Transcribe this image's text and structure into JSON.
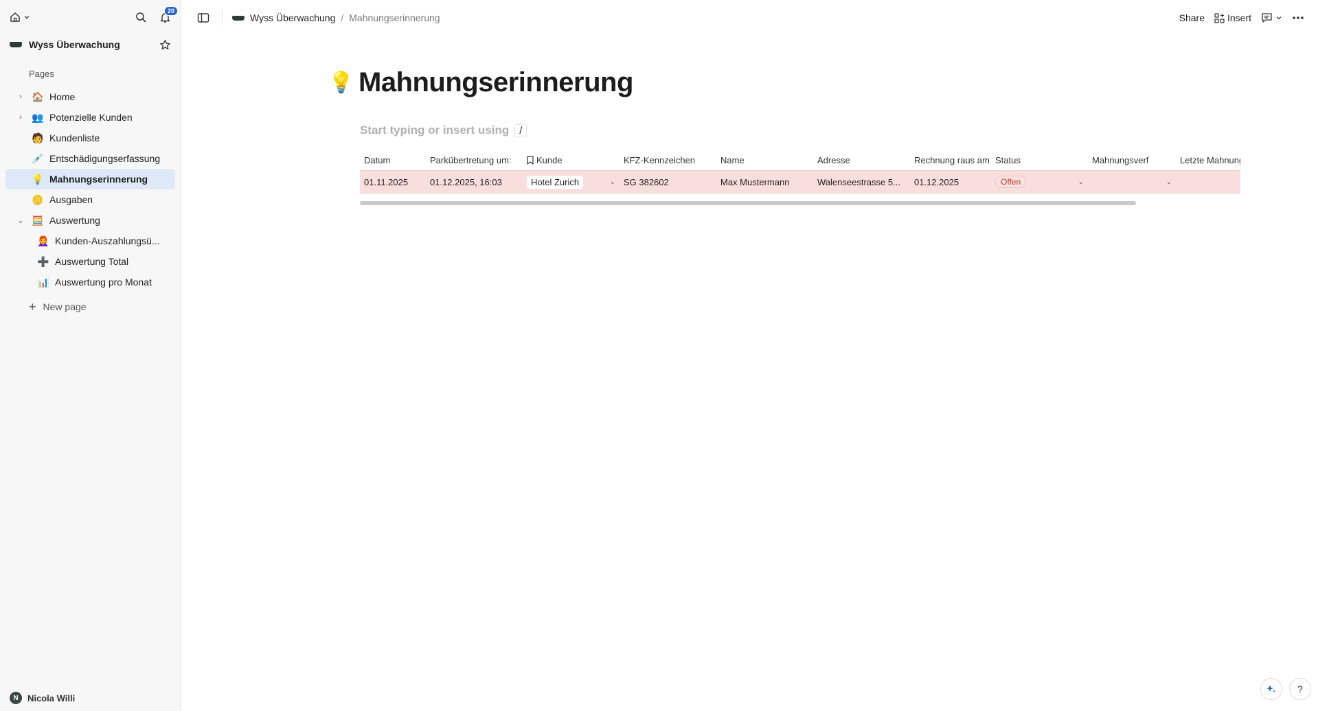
{
  "sidebar": {
    "workspace_name": "Wyss Überwachung",
    "notification_count": "20",
    "pages_label": "Pages",
    "items": [
      {
        "label": "Home"
      },
      {
        "label": "Potenzielle Kunden"
      },
      {
        "label": "Kundenliste"
      },
      {
        "label": "Entschädigungserfassung"
      },
      {
        "label": "Mahnungserinnerung"
      },
      {
        "label": "Ausgaben"
      },
      {
        "label": "Auswertung"
      },
      {
        "label": "Kunden-Auszahlungsü..."
      },
      {
        "label": "Auswertung Total"
      },
      {
        "label": "Auswertung pro Monat"
      }
    ],
    "new_page_label": "New page",
    "user_initial": "N",
    "user_name": "Nicola Willi"
  },
  "topbar": {
    "breadcrumb_workspace": "Wyss Überwachung",
    "breadcrumb_separator": "/",
    "breadcrumb_page": "Mahnungserinnerung",
    "share_label": "Share",
    "insert_label": "Insert"
  },
  "page": {
    "title": "Mahnungserinnerung",
    "hint_text": "Start typing or insert using",
    "hint_key": "/"
  },
  "table": {
    "headers": [
      "Datum",
      "Parkübertretung um:",
      "Kunde",
      "KFZ-Kennzeichen",
      "Name",
      "Adresse",
      "Rechnung raus am",
      "Status",
      "Mahnungsverf",
      "Letzte Mahnung"
    ],
    "rows": [
      {
        "datum": "01.11.2025",
        "park": "01.12.2025, 16:03",
        "kunde": "Hotel Zurich",
        "kfz": "SG 382602",
        "name": "Max Mustermann",
        "adresse": "Walenseestrasse 5...",
        "rechnung": "01.12.2025",
        "status": "Offen",
        "mahnungsverf": "",
        "letzte": ""
      }
    ]
  },
  "help_label": "?"
}
